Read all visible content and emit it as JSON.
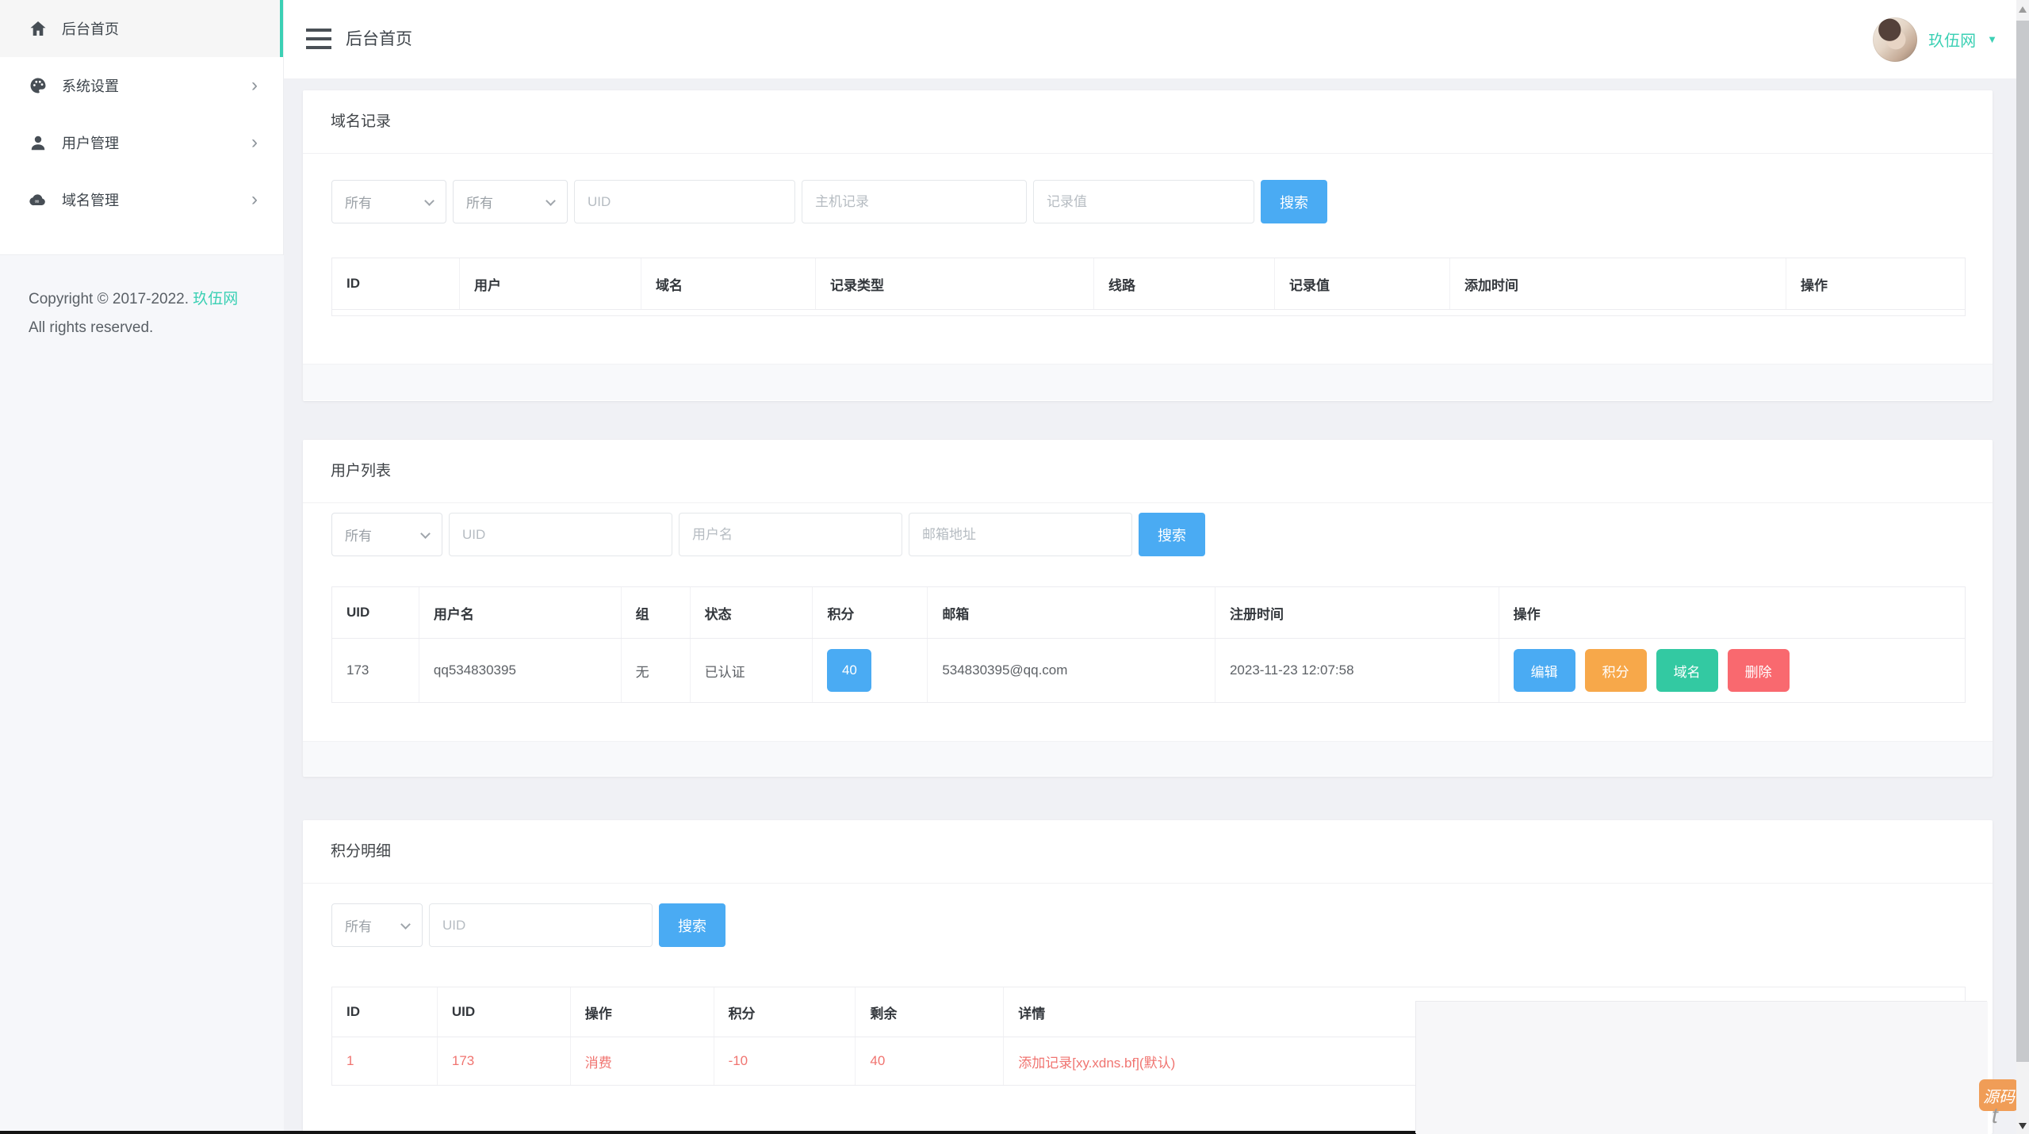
{
  "topbar": {
    "title": "后台首页",
    "username": "玖伍网",
    "caret": "▼"
  },
  "sidebar": {
    "items": [
      {
        "label": "后台首页",
        "icon": "home-icon",
        "active": true
      },
      {
        "label": "系统设置",
        "icon": "palette-icon",
        "chevron": "›"
      },
      {
        "label": "用户管理",
        "icon": "user-icon",
        "chevron": "›"
      },
      {
        "label": "域名管理",
        "icon": "cloud-icon",
        "chevron": "›"
      }
    ],
    "copyright": {
      "prefix": "Copyright © 2017-2022.",
      "brand": "玖伍网",
      "line2": "All rights reserved."
    }
  },
  "cards": [
    {
      "title": "域名记录",
      "filters": {
        "select1": "所有",
        "select2": "所有",
        "input1": "UID",
        "input2": "主机记录",
        "input3": "记录值",
        "search": "搜索"
      },
      "headers": [
        "ID",
        "用户",
        "域名",
        "记录类型",
        "线路",
        "记录值",
        "添加时间",
        "操作"
      ]
    },
    {
      "title": "用户列表",
      "filters": {
        "select1": "所有",
        "input1": "UID",
        "input2": "用户名",
        "input3": "邮箱地址",
        "search": "搜索"
      },
      "headers": [
        "UID",
        "用户名",
        "组",
        "状态",
        "积分",
        "邮箱",
        "注册时间",
        "操作"
      ],
      "row": {
        "uid": "173",
        "username": "qq534830395",
        "group": "无",
        "status": "已认证",
        "points": "40",
        "email": "534830395@qq.com",
        "registered": "2023-11-23 12:07:58"
      },
      "actions": [
        "编辑",
        "积分",
        "域名",
        "删除"
      ]
    },
    {
      "title": "积分明细",
      "filters": {
        "select1": "所有",
        "input1": "UID",
        "search": "搜索"
      },
      "headers": [
        "ID",
        "UID",
        "操作",
        "积分",
        "剩余",
        "详情"
      ],
      "row": {
        "id": "1",
        "uid": "173",
        "action": "消费",
        "points": "-10",
        "remain": "40",
        "detail": "添加记录[xy.xdns.bf](默认)"
      }
    }
  ],
  "colors": {
    "accent_teal": "#3bd0b4",
    "primary_blue": "#4aabf3",
    "button_orange": "#f7a84a",
    "button_green": "#33c9a2",
    "button_red": "#f9696f",
    "red_row_text": "#f07470",
    "page_bg": "#f0f1f5"
  },
  "watermark": {
    "badge": "源码",
    "letter": "t"
  }
}
